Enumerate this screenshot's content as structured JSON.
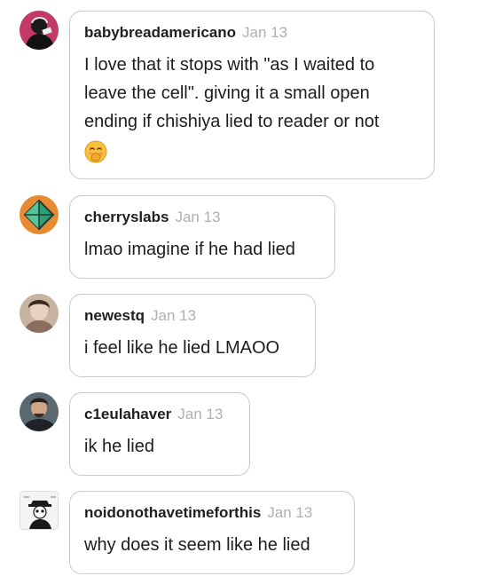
{
  "replies": [
    {
      "username": "babybreadamericano",
      "date": "Jan 13",
      "text": "I love that it stops with \"as I waited to leave the cell\". giving it a small open ending if chishiya lied to reader or not",
      "emoji": "hand-over-mouth-emoji",
      "avatar": "avatar-dark-figure-pink-bg"
    },
    {
      "username": "cherryslabs",
      "date": "Jan 13",
      "text": "lmao imagine if he had lied",
      "avatar": "avatar-green-crystal-orange-bg"
    },
    {
      "username": "newestq",
      "date": "Jan 13",
      "text": "i feel like he lied LMAOO",
      "avatar": "avatar-photo-person"
    },
    {
      "username": "c1eulahaver",
      "date": "Jan 13",
      "text": "ik he lied",
      "avatar": "avatar-photo-man"
    },
    {
      "username": "noidonothavetimeforthis",
      "date": "Jan 13",
      "text": "why does it seem like he lied",
      "avatar": "avatar-sketch-character"
    }
  ],
  "colors": {
    "border": "#c9c9c9",
    "date": "#b0b0b0",
    "text": "#1d1d1d"
  }
}
